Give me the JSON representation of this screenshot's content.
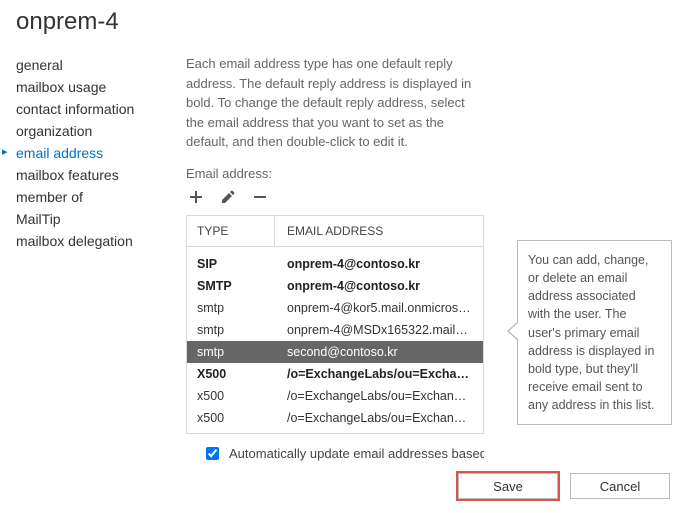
{
  "title": "onprem-4",
  "sidebar": {
    "items": [
      {
        "label": "general"
      },
      {
        "label": "mailbox usage"
      },
      {
        "label": "contact information"
      },
      {
        "label": "organization"
      },
      {
        "label": "email address",
        "active": true
      },
      {
        "label": "mailbox features"
      },
      {
        "label": "member of"
      },
      {
        "label": "MailTip"
      },
      {
        "label": "mailbox delegation"
      }
    ]
  },
  "main": {
    "description": "Each email address type has one default reply address. The default reply address is displayed in bold. To change the default reply address, select the email address that you want to set as the default, and then double-click to edit it.",
    "section_label": "Email address:",
    "table": {
      "headers": {
        "type": "TYPE",
        "address": "EMAIL ADDRESS"
      },
      "rows": [
        {
          "type": "SIP",
          "address": "onprem-4@contoso.kr",
          "bold": true
        },
        {
          "type": "SMTP",
          "address": "onprem-4@contoso.kr",
          "bold": true
        },
        {
          "type": "smtp",
          "address": "onprem-4@kor5.mail.onmicrosoft..."
        },
        {
          "type": "smtp",
          "address": "onprem-4@MSDx165322.mail.on..."
        },
        {
          "type": "smtp",
          "address": "second@contoso.kr",
          "selected": true
        },
        {
          "type": "X500",
          "address": "/o=ExchangeLabs/ou=Exchange...",
          "bold": true
        },
        {
          "type": "x500",
          "address": "/o=ExchangeLabs/ou=Exchange ..."
        },
        {
          "type": "x500",
          "address": "/o=ExchangeLabs/ou=Exchange ..."
        }
      ]
    },
    "checkbox": {
      "checked": true,
      "label": "Automatically update email addresses based"
    },
    "callout": "You can add, change, or delete an email address associated with the user. The user's primary email address is displayed in bold type, but they'll receive email sent to any address in this list.",
    "buttons": {
      "save": "Save",
      "cancel": "Cancel"
    }
  }
}
